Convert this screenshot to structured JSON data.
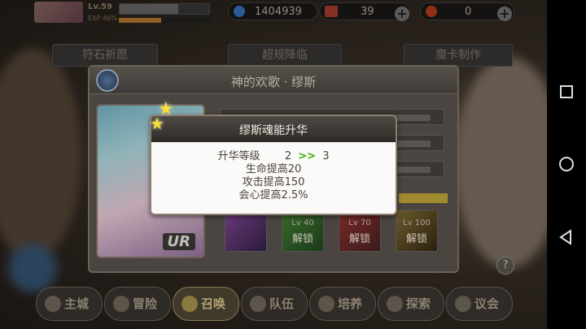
{
  "hud": {
    "level_label": "Lv.59",
    "exp_label": "EXP 46%",
    "level_progress": 0.65,
    "exp_progress": 0.46,
    "gems": "1404939",
    "tickets": "39",
    "hearts": "0"
  },
  "tabs": [
    "符石祈愿",
    "超规降临",
    "魔卡制作"
  ],
  "panel": {
    "title": "神的欢歌 · 缪斯",
    "card_rarity": "UR",
    "skills": [
      {
        "level": "",
        "lock": ""
      },
      {
        "level": "Lv 40",
        "lock": "解锁"
      },
      {
        "level": "Lv 70",
        "lock": "解锁"
      },
      {
        "level": "Lv 100",
        "lock": "解锁"
      }
    ]
  },
  "popup": {
    "title": "缪斯魂能升华",
    "level_label": "升华等级",
    "level_from": "2",
    "level_arrow": ">>",
    "level_to": "3",
    "bonuses": [
      "生命提高20",
      "攻击提高150",
      "会心提高2.5%"
    ]
  },
  "help": "?",
  "bottom_nav": [
    "主城",
    "冒险",
    "召唤",
    "队伍",
    "培养",
    "探索",
    "议会"
  ],
  "colors": {
    "arrow_green": "#38b000",
    "star_yellow": "#f6e040",
    "popup_bg": "#fbfaf8"
  }
}
